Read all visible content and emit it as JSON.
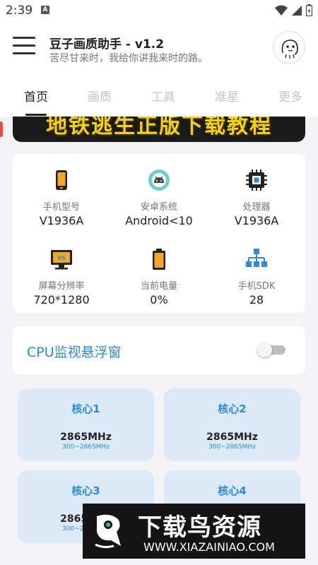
{
  "status": {
    "time": "2:39",
    "app_badge": "A"
  },
  "header": {
    "title": "豆子画质助手 - v1.2",
    "subtitle": "苦尽甘来时，我给你讲我来时的路。"
  },
  "tabs": [
    {
      "label": "首页",
      "active": true
    },
    {
      "label": "画质",
      "active": false
    },
    {
      "label": "工具",
      "active": false
    },
    {
      "label": "准星",
      "active": false
    },
    {
      "label": "更多",
      "active": false
    }
  ],
  "banner": {
    "text": "地铁逃生正版下载教程"
  },
  "device_info": [
    {
      "label": "手机型号",
      "value": "V1936A",
      "icon": "phone-icon"
    },
    {
      "label": "安卓系统",
      "value": "Android<10",
      "icon": "android-icon"
    },
    {
      "label": "处理器",
      "value": "V1936A",
      "icon": "cpu-chip-icon"
    },
    {
      "label": "屏幕分辨率",
      "value": "720*1280",
      "icon": "monitor-icon"
    },
    {
      "label": "当前电量",
      "value": "0%",
      "icon": "battery-icon"
    },
    {
      "label": "手机SDK",
      "value": "28",
      "icon": "network-icon"
    }
  ],
  "cpu_monitor": {
    "label": "CPU监视悬浮窗",
    "enabled": false
  },
  "cores": [
    {
      "title": "核心1",
      "freq": "2865MHz",
      "range": "300~2865MHz"
    },
    {
      "title": "核心2",
      "freq": "2865MHz",
      "range": "300~2865MHz"
    },
    {
      "title": "核心3",
      "freq": "2865MHz",
      "range": "300~2865MHz"
    },
    {
      "title": "核心4",
      "freq": "",
      "range": ""
    }
  ],
  "watermark": {
    "title": "下载鸟资源",
    "url": "WWW.XIAZAINIAO.COM"
  },
  "colors": {
    "accent": "#2a8bd8",
    "core_bg": "#dbe9f8",
    "banner_text": "#f4d300"
  }
}
